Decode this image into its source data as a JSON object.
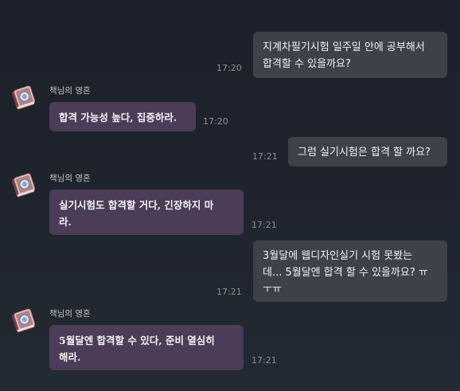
{
  "colors": {
    "user_bubble": "#3d4249",
    "bot_bubble": "#4b3c58",
    "background": "#1f242c",
    "time_text": "#8b9096"
  },
  "bot": {
    "name": "책님의 영혼",
    "avatar_icon": "spellbook-icon"
  },
  "messages": [
    {
      "role": "user",
      "text": "지계차필기시험 일주일 안에 공부해서\n합격할 수 있을까요?",
      "time": "17:20"
    },
    {
      "role": "bot",
      "text": "합격 가능성 높다, 집중하라.",
      "time": "17:20"
    },
    {
      "role": "user",
      "text": "그럼 실기시험은 합격 할 까요?",
      "time": "17:21"
    },
    {
      "role": "bot",
      "text": "실기시험도 합격할 거다, 긴장하지 마\n라.",
      "time": "17:21"
    },
    {
      "role": "user",
      "text": "3월달에 웹디자인실기 시험 못봤는\n데... 5월달엔 합격 할 수 있을까요? ㅠ\nㅜㅠ",
      "time": "17:21"
    },
    {
      "role": "bot",
      "text": "5월달엔 합격할 수 있다, 준비 열심히\n해라.",
      "time": "17:21"
    }
  ]
}
